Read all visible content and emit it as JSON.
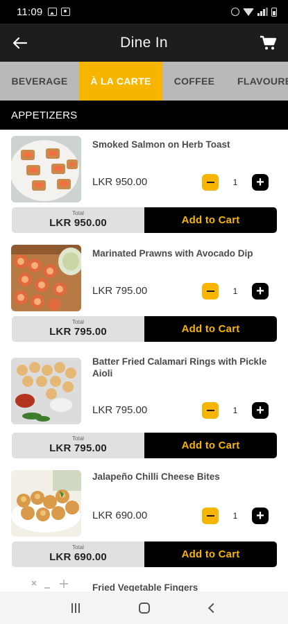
{
  "status_bar": {
    "time": "11:09"
  },
  "header": {
    "title": "Dine In"
  },
  "tabs": [
    {
      "label": "BEVERAGE",
      "active": false
    },
    {
      "label": "À LA CARTE",
      "active": true
    },
    {
      "label": "COFFEE",
      "active": false
    },
    {
      "label": "FLAVOURE",
      "active": false
    }
  ],
  "section": {
    "title": "APPETIZERS"
  },
  "items": [
    {
      "name": "Smoked Salmon on Herb Toast",
      "price": "LKR 950.00",
      "qty": "1",
      "total_label": "Total",
      "total": "LKR 950.00",
      "button": "Add to Cart"
    },
    {
      "name": "Marinated Prawns with Avocado Dip",
      "price": "LKR 795.00",
      "qty": "1",
      "total_label": "Total",
      "total": "LKR 795.00",
      "button": "Add to Cart"
    },
    {
      "name": "Batter Fried Calamari Rings with Pickle Aioli",
      "price": "LKR 795.00",
      "qty": "1",
      "total_label": "Total",
      "total": "LKR 795.00",
      "button": "Add to Cart"
    },
    {
      "name": "Jalapeño Chilli Cheese Bites",
      "price": "LKR 690.00",
      "qty": "1",
      "total_label": "Total",
      "total": "LKR 690.00",
      "button": "Add to Cart"
    },
    {
      "name": "Fried Vegetable Fingers"
    }
  ],
  "colors": {
    "accent": "#f7b500",
    "header_bg": "#1d1d1d",
    "tab_bg": "#b9b9b9",
    "black": "#000000"
  },
  "icons": {
    "back": "arrow-left-icon",
    "cart": "shopping-cart-icon",
    "minus": "minus-icon",
    "plus": "plus-icon"
  }
}
